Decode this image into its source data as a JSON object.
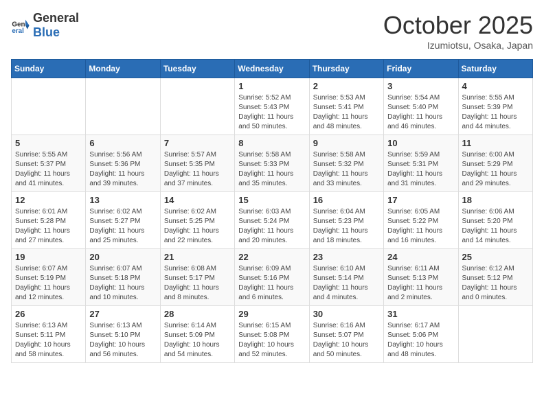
{
  "header": {
    "logo_general": "General",
    "logo_blue": "Blue",
    "month_title": "October 2025",
    "location": "Izumiotsu, Osaka, Japan"
  },
  "days_of_week": [
    "Sunday",
    "Monday",
    "Tuesday",
    "Wednesday",
    "Thursday",
    "Friday",
    "Saturday"
  ],
  "weeks": [
    [
      {
        "day": "",
        "info": ""
      },
      {
        "day": "",
        "info": ""
      },
      {
        "day": "",
        "info": ""
      },
      {
        "day": "1",
        "info": "Sunrise: 5:52 AM\nSunset: 5:43 PM\nDaylight: 11 hours\nand 50 minutes."
      },
      {
        "day": "2",
        "info": "Sunrise: 5:53 AM\nSunset: 5:41 PM\nDaylight: 11 hours\nand 48 minutes."
      },
      {
        "day": "3",
        "info": "Sunrise: 5:54 AM\nSunset: 5:40 PM\nDaylight: 11 hours\nand 46 minutes."
      },
      {
        "day": "4",
        "info": "Sunrise: 5:55 AM\nSunset: 5:39 PM\nDaylight: 11 hours\nand 44 minutes."
      }
    ],
    [
      {
        "day": "5",
        "info": "Sunrise: 5:55 AM\nSunset: 5:37 PM\nDaylight: 11 hours\nand 41 minutes."
      },
      {
        "day": "6",
        "info": "Sunrise: 5:56 AM\nSunset: 5:36 PM\nDaylight: 11 hours\nand 39 minutes."
      },
      {
        "day": "7",
        "info": "Sunrise: 5:57 AM\nSunset: 5:35 PM\nDaylight: 11 hours\nand 37 minutes."
      },
      {
        "day": "8",
        "info": "Sunrise: 5:58 AM\nSunset: 5:33 PM\nDaylight: 11 hours\nand 35 minutes."
      },
      {
        "day": "9",
        "info": "Sunrise: 5:58 AM\nSunset: 5:32 PM\nDaylight: 11 hours\nand 33 minutes."
      },
      {
        "day": "10",
        "info": "Sunrise: 5:59 AM\nSunset: 5:31 PM\nDaylight: 11 hours\nand 31 minutes."
      },
      {
        "day": "11",
        "info": "Sunrise: 6:00 AM\nSunset: 5:29 PM\nDaylight: 11 hours\nand 29 minutes."
      }
    ],
    [
      {
        "day": "12",
        "info": "Sunrise: 6:01 AM\nSunset: 5:28 PM\nDaylight: 11 hours\nand 27 minutes."
      },
      {
        "day": "13",
        "info": "Sunrise: 6:02 AM\nSunset: 5:27 PM\nDaylight: 11 hours\nand 25 minutes."
      },
      {
        "day": "14",
        "info": "Sunrise: 6:02 AM\nSunset: 5:25 PM\nDaylight: 11 hours\nand 22 minutes."
      },
      {
        "day": "15",
        "info": "Sunrise: 6:03 AM\nSunset: 5:24 PM\nDaylight: 11 hours\nand 20 minutes."
      },
      {
        "day": "16",
        "info": "Sunrise: 6:04 AM\nSunset: 5:23 PM\nDaylight: 11 hours\nand 18 minutes."
      },
      {
        "day": "17",
        "info": "Sunrise: 6:05 AM\nSunset: 5:22 PM\nDaylight: 11 hours\nand 16 minutes."
      },
      {
        "day": "18",
        "info": "Sunrise: 6:06 AM\nSunset: 5:20 PM\nDaylight: 11 hours\nand 14 minutes."
      }
    ],
    [
      {
        "day": "19",
        "info": "Sunrise: 6:07 AM\nSunset: 5:19 PM\nDaylight: 11 hours\nand 12 minutes."
      },
      {
        "day": "20",
        "info": "Sunrise: 6:07 AM\nSunset: 5:18 PM\nDaylight: 11 hours\nand 10 minutes."
      },
      {
        "day": "21",
        "info": "Sunrise: 6:08 AM\nSunset: 5:17 PM\nDaylight: 11 hours\nand 8 minutes."
      },
      {
        "day": "22",
        "info": "Sunrise: 6:09 AM\nSunset: 5:16 PM\nDaylight: 11 hours\nand 6 minutes."
      },
      {
        "day": "23",
        "info": "Sunrise: 6:10 AM\nSunset: 5:14 PM\nDaylight: 11 hours\nand 4 minutes."
      },
      {
        "day": "24",
        "info": "Sunrise: 6:11 AM\nSunset: 5:13 PM\nDaylight: 11 hours\nand 2 minutes."
      },
      {
        "day": "25",
        "info": "Sunrise: 6:12 AM\nSunset: 5:12 PM\nDaylight: 11 hours\nand 0 minutes."
      }
    ],
    [
      {
        "day": "26",
        "info": "Sunrise: 6:13 AM\nSunset: 5:11 PM\nDaylight: 10 hours\nand 58 minutes."
      },
      {
        "day": "27",
        "info": "Sunrise: 6:13 AM\nSunset: 5:10 PM\nDaylight: 10 hours\nand 56 minutes."
      },
      {
        "day": "28",
        "info": "Sunrise: 6:14 AM\nSunset: 5:09 PM\nDaylight: 10 hours\nand 54 minutes."
      },
      {
        "day": "29",
        "info": "Sunrise: 6:15 AM\nSunset: 5:08 PM\nDaylight: 10 hours\nand 52 minutes."
      },
      {
        "day": "30",
        "info": "Sunrise: 6:16 AM\nSunset: 5:07 PM\nDaylight: 10 hours\nand 50 minutes."
      },
      {
        "day": "31",
        "info": "Sunrise: 6:17 AM\nSunset: 5:06 PM\nDaylight: 10 hours\nand 48 minutes."
      },
      {
        "day": "",
        "info": ""
      }
    ]
  ]
}
